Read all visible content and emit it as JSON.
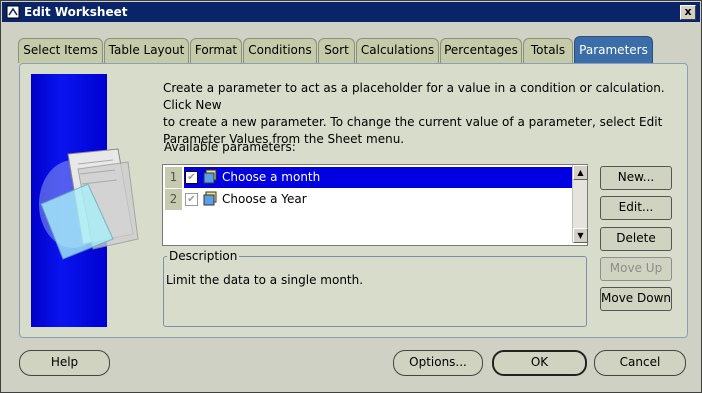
{
  "window": {
    "title": "Edit Worksheet",
    "close_glyph": "x"
  },
  "tabs": [
    {
      "label": "Select Items"
    },
    {
      "label": "Table Layout"
    },
    {
      "label": "Format"
    },
    {
      "label": "Conditions"
    },
    {
      "label": "Sort"
    },
    {
      "label": "Calculations"
    },
    {
      "label": "Percentages"
    },
    {
      "label": "Totals"
    },
    {
      "label": "Parameters",
      "active": true
    }
  ],
  "parameters_tab": {
    "instructions": [
      "Create a parameter to act as a placeholder for a value in a condition or calculation.  Click New",
      "to create a new parameter.  To change the current value of a parameter, select Edit",
      "Parameter Values from the Sheet menu."
    ],
    "available_label": "Available parameters:",
    "parameters": [
      {
        "index": "1",
        "name": "Choose a month",
        "checked": true,
        "selected": true
      },
      {
        "index": "2",
        "name": "Choose a Year",
        "checked": true,
        "selected": false
      }
    ],
    "description_label": "Description",
    "description": "Limit the data to a single month.",
    "side_buttons": {
      "new": "New...",
      "edit": "Edit...",
      "delete": "Delete",
      "move_up": "Move Up",
      "move_down": "Move Down"
    }
  },
  "footer": {
    "help": "Help",
    "options": "Options...",
    "ok": "OK",
    "cancel": "Cancel"
  },
  "icons": {
    "title": "worksheet-icon",
    "parameter": "parameter-icon",
    "check": "checkmark-icon",
    "scroll_up": "arrow-up-icon",
    "scroll_down": "arrow-down-icon"
  },
  "colors": {
    "title_bar": "#0a246a",
    "active_tab": "#3b6ea8",
    "selection": "#0000e0",
    "side_image": "#0000c8"
  }
}
